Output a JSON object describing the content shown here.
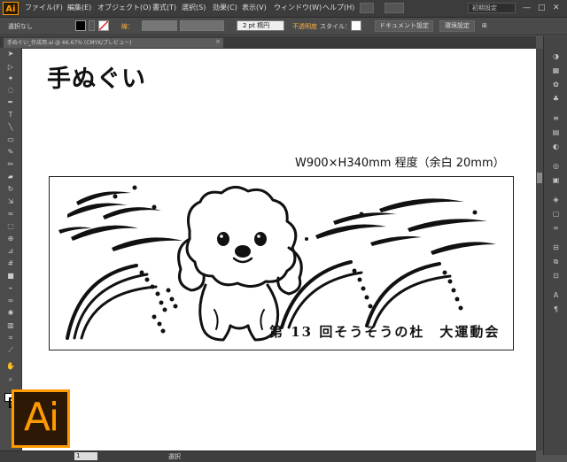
{
  "app": {
    "badge": "Ai",
    "logo": "Ai"
  },
  "menu": {
    "items": [
      "ファイル(F)",
      "編集(E)",
      "オブジェクト(O)",
      "書式(T)",
      "選択(S)",
      "効果(C)",
      "表示(V)",
      "ウィンドウ(W)",
      "ヘルプ(H)"
    ],
    "workspace": "初期設定",
    "window_controls": [
      "—",
      "□",
      "✕"
    ]
  },
  "control_bar": {
    "selection": "選択なし",
    "stroke_label": "線：",
    "stroke_weight": "2 pt 楕円",
    "opacity_label": "不透明度",
    "style_label": "スタイル：",
    "doc_settings_button": "ドキュメント設定",
    "prefs_button": "環境設定"
  },
  "document_tab": {
    "label": "手ぬぐい_作成用.ai @ 66.67% (CMYK/プレビュー)",
    "close": "×"
  },
  "artboard": {
    "title": "手ぬぐい",
    "dimensions": "W900×H340mm 程度（余白 20mm）",
    "event_text": "第 13 回そうそうの杜　大運動会"
  },
  "status": {
    "zoom": "1",
    "label": "選択"
  },
  "colors": {
    "accent": "#ff9a00",
    "chrome": "#535353",
    "canvas": "#ffffff"
  },
  "icons": {
    "tools": [
      "selection-tool-icon",
      "direct-selection-tool-icon",
      "magic-wand-icon",
      "lasso-icon",
      "pen-tool-icon",
      "type-tool-icon",
      "line-tool-icon",
      "rectangle-tool-icon",
      "paintbrush-icon",
      "pencil-icon",
      "eraser-icon",
      "rotate-icon",
      "scale-icon",
      "width-tool-icon",
      "free-transform-icon",
      "shape-builder-icon",
      "perspective-grid-icon",
      "mesh-icon",
      "gradient-icon",
      "eyedropper-icon",
      "blend-icon",
      "symbol-sprayer-icon",
      "column-graph-icon",
      "artboard-tool-icon",
      "slice-tool-icon",
      "hand-tool-icon",
      "zoom-tool-icon"
    ],
    "panels": [
      "color-panel-icon",
      "swatches-icon",
      "brushes-icon",
      "symbols-icon",
      "stroke-icon",
      "gradient-panel-icon",
      "transparency-icon",
      "appearance-icon",
      "graphic-styles-icon",
      "layers-icon",
      "artboards-icon",
      "links-icon",
      "align-icon",
      "pathfinder-icon",
      "transform-icon",
      "character-icon",
      "paragraph-icon"
    ]
  }
}
